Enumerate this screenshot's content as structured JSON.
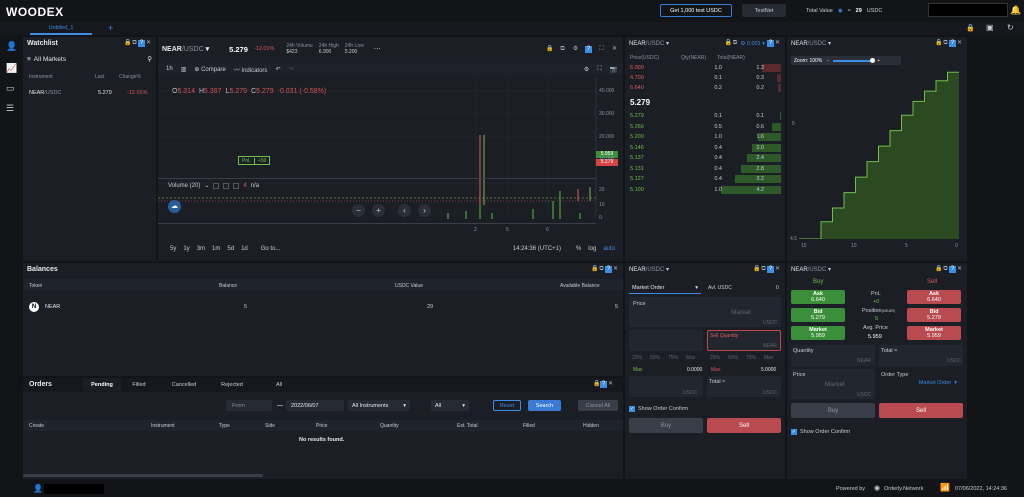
{
  "app": {
    "logo": "WOODEX",
    "tab": "Untitled_1",
    "get_test": "Get 1,000 test USDC",
    "testnet": "TestNet",
    "total_value_label": "Total Value",
    "total_value": "29",
    "total_value_unit": "USDC",
    "approx": "≈"
  },
  "watchlist": {
    "title": "Watchlist",
    "filter": "All Markets",
    "cols": [
      "Instrument",
      "Last",
      "Change%"
    ],
    "rows": [
      {
        "sym": "NEAR",
        "quote": "/USDC",
        "last": "5.279",
        "chg": "-12.01%"
      }
    ]
  },
  "chart": {
    "symbol": "NEAR",
    "quote": "/USDC",
    "price": "5.279",
    "change": "-12.01%",
    "vol_label": "24h Volume",
    "vol": "$423",
    "high_label": "24h High",
    "high": "6.900",
    "low_label": "24h Low",
    "low": "5.200",
    "interval": "1h",
    "compare": "Compare",
    "indicators": "Indicators",
    "ohlc": {
      "o_lbl": "O",
      "o": "5.314",
      "h_lbl": "H",
      "h": "5.367",
      "l_lbl": "L",
      "l": "5.279",
      "c_lbl": "C",
      "c": "5.279",
      "delta": "-0.031 (-0.58%)"
    },
    "pnl": "PnL",
    "pnl_val": "+50",
    "price_tags": [
      "5.959",
      "5.279"
    ],
    "y_ticks": [
      "40.000",
      "30.000",
      "20.000",
      "10.000",
      "0.000"
    ],
    "vol_ticks": [
      "20",
      "10",
      "0"
    ],
    "volume_label": "Volume (20)",
    "volume_val": "n/a",
    "volume_num": "4",
    "x_ticks": [
      "2",
      "5",
      "6"
    ],
    "ranges": [
      "5y",
      "1y",
      "3m",
      "1m",
      "5d",
      "1d"
    ],
    "goto": "Go to...",
    "time": "14:24:36 (UTC+1)",
    "pct": "%",
    "log": "log",
    "auto": "auto"
  },
  "orderbook": {
    "symbol": "NEAR",
    "quote": "/USDC",
    "tick": "0.001",
    "cols": [
      "Price(USDC)",
      "Qty(NEAR)",
      "Total(NEAR)"
    ],
    "asks": [
      {
        "p": "6.000",
        "q": "1.0",
        "t": "1.3"
      },
      {
        "p": "4.700",
        "q": "0.1",
        "t": "0.3"
      },
      {
        "p": "6.640",
        "q": "0.2",
        "t": "0.2"
      }
    ],
    "mid": "5.279",
    "bids": [
      {
        "p": "5.279",
        "q": "0.1",
        "t": "0.1"
      },
      {
        "p": "5.266",
        "q": "0.5",
        "t": "0.6"
      },
      {
        "p": "5.200",
        "q": "1.0",
        "t": "1.6"
      },
      {
        "p": "5.146",
        "q": "0.4",
        "t": "2.0"
      },
      {
        "p": "5.137",
        "q": "0.4",
        "t": "2.4"
      },
      {
        "p": "5.131",
        "q": "0.4",
        "t": "2.8"
      },
      {
        "p": "5.127",
        "q": "0.4",
        "t": "3.2"
      },
      {
        "p": "5.100",
        "q": "1.0",
        "t": "4.2"
      }
    ]
  },
  "depth": {
    "symbol": "NEAR",
    "quote": "/USDC",
    "zoom": "Zoom: 100%",
    "y_ticks": [
      "5",
      "4.5"
    ],
    "x_ticks": [
      "15",
      "10",
      "5",
      "0"
    ],
    "steps": [
      0.1,
      0.18,
      0.27,
      0.36,
      0.45,
      0.54,
      0.63,
      0.72,
      0.8,
      0.86,
      0.92,
      0.97
    ]
  },
  "balances": {
    "title": "Balances",
    "cols": [
      "Token",
      "Balance",
      "USDC Value",
      "Available Balance"
    ],
    "rows": [
      {
        "token": "NEAR",
        "balance": "5",
        "value": "29",
        "avail": "5"
      }
    ]
  },
  "orders": {
    "title": "Orders",
    "tabs": [
      "Pending",
      "Filled",
      "Cancelled",
      "Rejected",
      "All"
    ],
    "from": "From",
    "to": "2022/06/07",
    "instruments": "All Instruments",
    "side": "All",
    "reset": "Reset",
    "search": "Search",
    "cancel_all": "Cancel All",
    "cols": [
      "Create",
      "Instrument",
      "Type",
      "Side",
      "Price",
      "Quantity",
      "Est. Total",
      "Filled",
      "Hidden"
    ],
    "empty": "No results found."
  },
  "order_form": {
    "symbol": "NEAR",
    "quote": "/USDC",
    "type": "Market Order",
    "avl": "Avl. USDC",
    "avl_val": "0",
    "price": "Price",
    "market": "Market",
    "usdc": "USDC",
    "near": "NEAR",
    "sell_qty": "Sell Quantity",
    "pcts": [
      "25%",
      "50%",
      "75%",
      "Max"
    ],
    "max": "Max",
    "max_left": "0.0000",
    "max_right": "5.0000",
    "total": "Total",
    "approx": "≈",
    "confirm": "Show Order Confirm",
    "buy": "Buy",
    "sell": "Sell"
  },
  "quick": {
    "symbol": "NEAR",
    "quote": "/USDC",
    "buy": "Buy",
    "sell": "Sell",
    "ask": "Ask",
    "ask_val": "6.640",
    "bid": "Bid",
    "bid_val": "5.279",
    "market": "Market",
    "market_val": "5.959",
    "pnl": "PnL",
    "pnl_val": "+0",
    "position": "Position",
    "position_sub": "(NEAR)",
    "position_val": "5",
    "avg_price": "Avg. Price",
    "avg_val": "5.959",
    "quantity": "Quantity",
    "total": "Total",
    "approx": "≈",
    "near": "NEAR",
    "usdc": "USDC",
    "price": "Price",
    "market_ph": "Market",
    "order_type": "Order Type",
    "order_type_val": "Market Order",
    "confirm": "Show Order Confirm"
  },
  "footer": {
    "powered": "Powered by",
    "orderly": "Orderly.Network",
    "datetime": "07/06/2022, 14:24:36"
  }
}
